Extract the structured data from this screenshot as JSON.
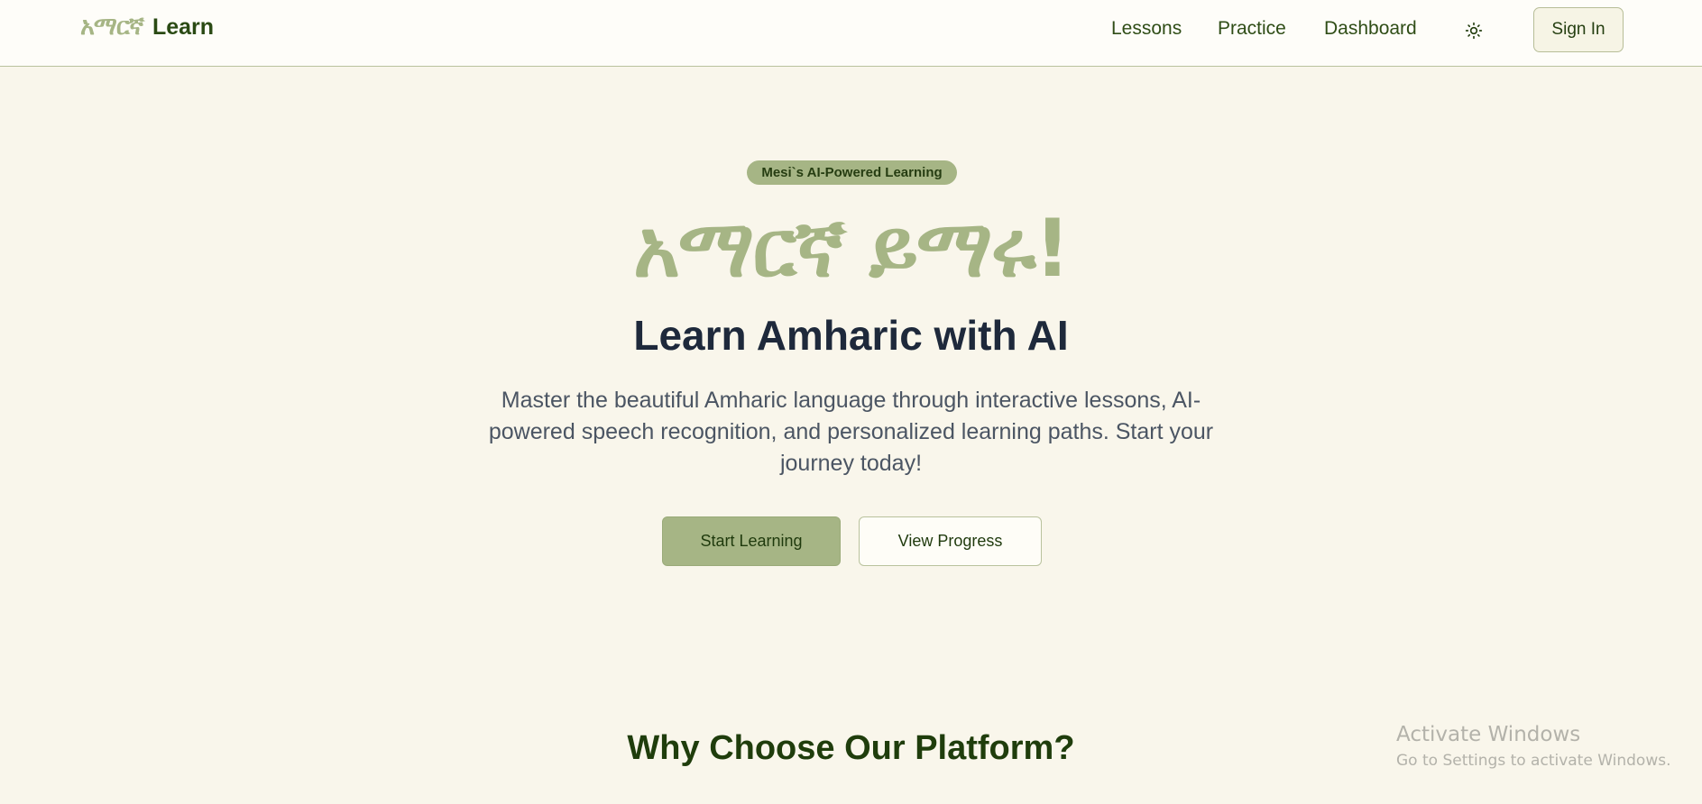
{
  "header": {
    "logo_amharic": "አማርኛ",
    "logo_text": "Learn",
    "nav": {
      "lessons": "Lessons",
      "practice": "Practice",
      "dashboard": "Dashboard"
    },
    "theme_icon": "sun-icon",
    "sign_in": "Sign In"
  },
  "hero": {
    "badge": "Mesi`s AI-Powered Learning",
    "amharic_heading": "አማርኛ ይማሩ!",
    "title": "Learn Amharic with AI",
    "description": "Master the beautiful Amharic language through interactive lessons, AI-powered speech recognition, and personalized learning paths. Start your journey today!",
    "primary_button": "Start Learning",
    "secondary_button": "View Progress"
  },
  "features": {
    "title": "Why Choose Our Platform?"
  },
  "watermark": {
    "title": "Activate Windows",
    "subtitle": "Go to Settings to activate Windows."
  },
  "colors": {
    "background": "#f9f6eb",
    "accent": "#a6b585",
    "dark_green": "#2a4a14",
    "heading": "#1e293b"
  }
}
